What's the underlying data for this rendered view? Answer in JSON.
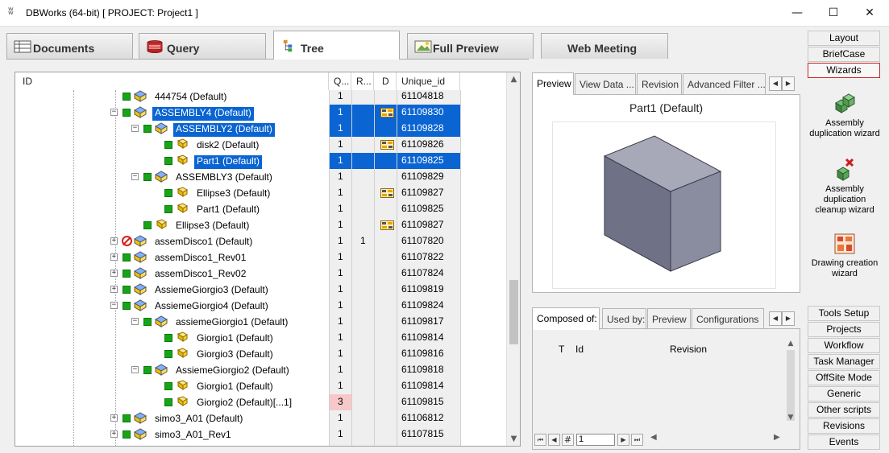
{
  "window": {
    "title": "DBWorks (64-bit) [ PROJECT: Project1 ]",
    "minimize": "—",
    "maximize": "☐",
    "close": "✕"
  },
  "main_tabs": [
    {
      "label": "Documents",
      "icon": "documents-icon",
      "active": false
    },
    {
      "label": "Query",
      "icon": "query-icon",
      "active": false
    },
    {
      "label": "Tree",
      "icon": "tree-icon",
      "active": true
    },
    {
      "label": "Full Preview",
      "icon": "full-preview-icon",
      "active": false
    },
    {
      "label": "Web Meeting",
      "icon": "",
      "active": false
    }
  ],
  "tree": {
    "columns": {
      "id": "ID",
      "q": "Q...",
      "r": "R...",
      "d": "D",
      "uid": "Unique_id"
    },
    "rows": [
      {
        "name": "444754 (Default)",
        "q": "1",
        "r": "",
        "d": false,
        "uid": "61104818",
        "level": 1,
        "expand": false,
        "status": "ok",
        "kind": "asm",
        "selected": false
      },
      {
        "name": "ASSEMBLY4 (Default)",
        "q": "1",
        "r": "",
        "d": true,
        "uid": "61109830",
        "level": 1,
        "expand": "minus",
        "status": "ok",
        "kind": "asm",
        "selected": true
      },
      {
        "name": "ASSEMBLY2 (Default)",
        "q": "1",
        "r": "",
        "d": false,
        "uid": "61109828",
        "level": 2,
        "expand": "minus",
        "status": "ok",
        "kind": "asm",
        "selected": true
      },
      {
        "name": "disk2 (Default)",
        "q": "1",
        "r": "",
        "d": true,
        "uid": "61109826",
        "level": 3,
        "expand": false,
        "status": "ok",
        "kind": "part",
        "selected": false
      },
      {
        "name": "Part1 (Default)",
        "q": "1",
        "r": "",
        "d": false,
        "uid": "61109825",
        "level": 3,
        "expand": false,
        "status": "ok",
        "kind": "part",
        "selected": true
      },
      {
        "name": "ASSEMBLY3 (Default)",
        "q": "1",
        "r": "",
        "d": false,
        "uid": "61109829",
        "level": 2,
        "expand": "minus",
        "status": "ok",
        "kind": "asm",
        "selected": false
      },
      {
        "name": "Ellipse3 (Default)",
        "q": "1",
        "r": "",
        "d": true,
        "uid": "61109827",
        "level": 3,
        "expand": false,
        "status": "ok",
        "kind": "part",
        "selected": false
      },
      {
        "name": "Part1 (Default)",
        "q": "1",
        "r": "",
        "d": false,
        "uid": "61109825",
        "level": 3,
        "expand": false,
        "status": "ok",
        "kind": "part",
        "selected": false
      },
      {
        "name": "Ellipse3 (Default)",
        "q": "1",
        "r": "",
        "d": true,
        "uid": "61109827",
        "level": 2,
        "expand": false,
        "status": "ok",
        "kind": "part",
        "selected": false
      },
      {
        "name": "assemDisco1 (Default)",
        "q": "1",
        "r": "1",
        "d": false,
        "uid": "61107820",
        "level": 1,
        "expand": "plus",
        "status": "blocked",
        "kind": "asm",
        "selected": false
      },
      {
        "name": "assemDisco1_Rev01",
        "q": "1",
        "r": "",
        "d": false,
        "uid": "61107822",
        "level": 1,
        "expand": "plus",
        "status": "ok",
        "kind": "asm",
        "selected": false
      },
      {
        "name": "assemDisco1_Rev02",
        "q": "1",
        "r": "",
        "d": false,
        "uid": "61107824",
        "level": 1,
        "expand": "plus",
        "status": "ok",
        "kind": "asm",
        "selected": false
      },
      {
        "name": "AssiemeGiorgio3 (Default)",
        "q": "1",
        "r": "",
        "d": false,
        "uid": "61109819",
        "level": 1,
        "expand": "plus",
        "status": "ok",
        "kind": "asm",
        "selected": false
      },
      {
        "name": "AssiemeGiorgio4 (Default)",
        "q": "1",
        "r": "",
        "d": false,
        "uid": "61109824",
        "level": 1,
        "expand": "minus",
        "status": "ok",
        "kind": "asm",
        "selected": false
      },
      {
        "name": "assiemeGiorgio1 (Default)",
        "q": "1",
        "r": "",
        "d": false,
        "uid": "61109817",
        "level": 2,
        "expand": "minus",
        "status": "ok",
        "kind": "asm",
        "selected": false
      },
      {
        "name": "Giorgio1 (Default)",
        "q": "1",
        "r": "",
        "d": false,
        "uid": "61109814",
        "level": 3,
        "expand": false,
        "status": "ok",
        "kind": "part",
        "selected": false
      },
      {
        "name": "Giorgio3 (Default)",
        "q": "1",
        "r": "",
        "d": false,
        "uid": "61109816",
        "level": 3,
        "expand": false,
        "status": "ok",
        "kind": "part",
        "selected": false
      },
      {
        "name": "AssiemeGiorgio2 (Default)",
        "q": "1",
        "r": "",
        "d": false,
        "uid": "61109818",
        "level": 2,
        "expand": "minus",
        "status": "ok",
        "kind": "asm",
        "selected": false
      },
      {
        "name": "Giorgio1 (Default)",
        "q": "1",
        "r": "",
        "d": false,
        "uid": "61109814",
        "level": 3,
        "expand": false,
        "status": "ok",
        "kind": "part",
        "selected": false
      },
      {
        "name": "Giorgio2 (Default)[...1]",
        "q": "3",
        "r": "",
        "d": false,
        "uid": "61109815",
        "level": 3,
        "expand": false,
        "status": "ok",
        "kind": "part",
        "selected": false,
        "q_highlight": true
      },
      {
        "name": "simo3_A01 (Default)",
        "q": "1",
        "r": "",
        "d": false,
        "uid": "61106812",
        "level": 1,
        "expand": "plus",
        "status": "ok",
        "kind": "asm",
        "selected": false
      },
      {
        "name": "simo3_A01_Rev1",
        "q": "1",
        "r": "",
        "d": false,
        "uid": "61107815",
        "level": 1,
        "expand": "plus",
        "status": "ok",
        "kind": "asm",
        "selected": false
      }
    ]
  },
  "preview": {
    "tabs": [
      "Preview",
      "View Data ...",
      "Revision",
      "Advanced Filter ..."
    ],
    "title": "Part1 (Default)"
  },
  "composed": {
    "tabs": [
      "Composed of:",
      "Used by:",
      "Preview",
      "Configurations"
    ],
    "columns": {
      "t": "T",
      "id": "Id",
      "revision": "Revision"
    },
    "nav": {
      "hash": "#",
      "page": "1"
    }
  },
  "sidebar": {
    "top": [
      "Layout",
      "BriefCase",
      "Wizards"
    ],
    "active": "Wizards",
    "wizards": [
      "Assembly duplication wizard",
      "Assembly duplication cleanup wizard",
      "Drawing creation wizard"
    ],
    "bottom": [
      "Tools Setup",
      "Projects",
      "Workflow",
      "Task Manager",
      "OffSite Mode",
      "Generic",
      "Other scripts",
      "Revisions",
      "Events"
    ]
  },
  "colors": {
    "selection": "#0a64d2",
    "status_ok": "#18a418",
    "status_blocked": "#d81e1e",
    "wizard_active_border": "#c42b2b"
  }
}
